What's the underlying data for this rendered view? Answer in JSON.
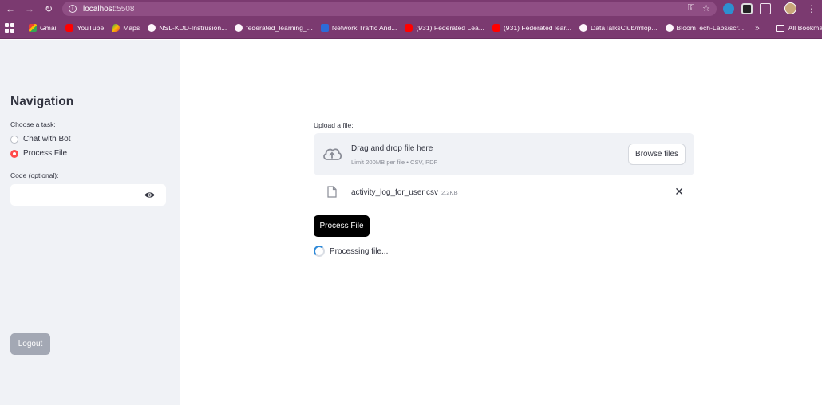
{
  "browser": {
    "url_host": "localhost",
    "url_port": ":5508",
    "bookmarks": [
      {
        "label": "Gmail",
        "icon": "gmail-icon"
      },
      {
        "label": "YouTube",
        "icon": "youtube-icon"
      },
      {
        "label": "Maps",
        "icon": "maps-icon"
      },
      {
        "label": "NSL-KDD-Instrusion...",
        "icon": "github-icon"
      },
      {
        "label": "federated_learning_...",
        "icon": "github-icon"
      },
      {
        "label": "Network Traffic And...",
        "icon": "linkedin-icon"
      },
      {
        "label": "(931) Federated Lea...",
        "icon": "youtube-icon"
      },
      {
        "label": "(931) Federated lear...",
        "icon": "youtube-icon"
      },
      {
        "label": "DataTalksClub/mlop...",
        "icon": "github-icon"
      },
      {
        "label": "BloomTech-Labs/scr...",
        "icon": "github-icon"
      }
    ],
    "more": "»",
    "all_bookmarks": "All Bookmarks"
  },
  "sidebar": {
    "title": "Navigation",
    "task_label": "Choose a task:",
    "options": [
      {
        "label": "Chat with Bot",
        "selected": false
      },
      {
        "label": "Process File",
        "selected": true
      }
    ],
    "code_label": "Code (optional):",
    "code_value": "",
    "logout_label": "Logout"
  },
  "main": {
    "upload_label": "Upload a file:",
    "dropzone_title": "Drag and drop file here",
    "dropzone_hint": "Limit 200MB per file • CSV, PDF",
    "browse_label": "Browse files",
    "file": {
      "name": "activity_log_for_user.csv",
      "size": "2.2KB"
    },
    "process_label": "Process File",
    "status_text": "Processing file..."
  },
  "colors": {
    "chrome": "#7b3a70",
    "sidebar_bg": "#f0f2f6",
    "radio_selected": "#ff4b4b",
    "primary_button": "#000000",
    "spinner": "#2e89d8"
  }
}
